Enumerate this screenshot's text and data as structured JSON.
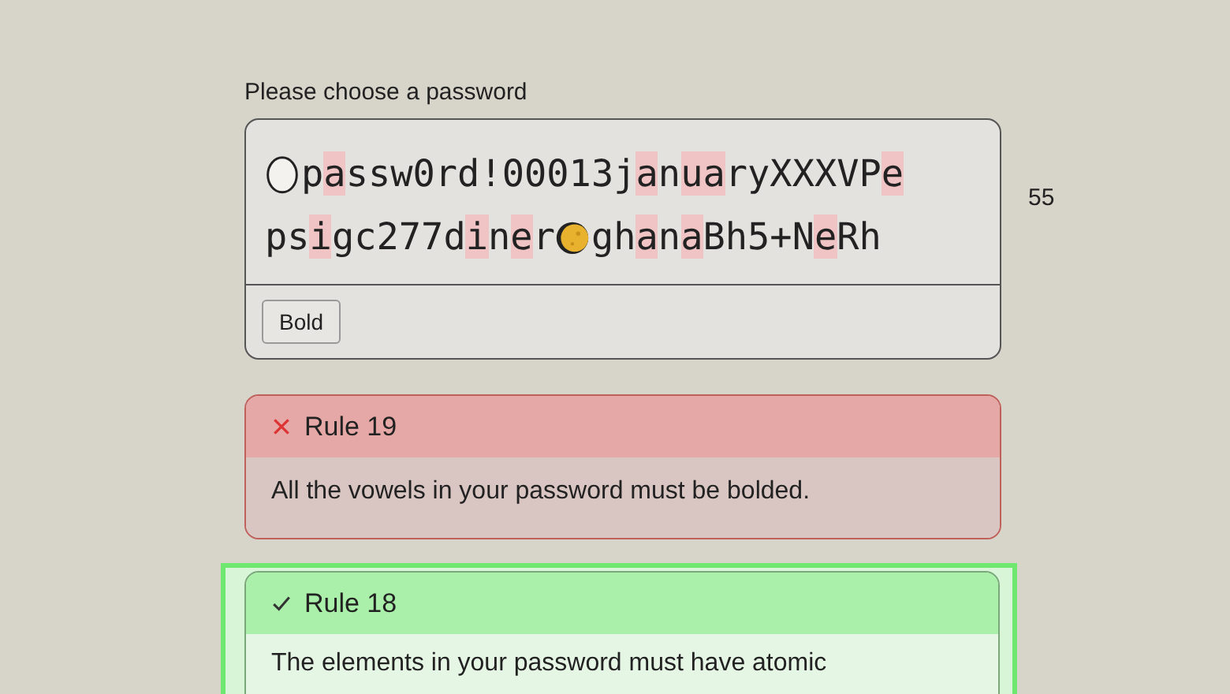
{
  "password_label": "Please choose a password",
  "password_lines": [
    [
      {
        "kind": "egg"
      },
      {
        "kind": "text",
        "text": "p",
        "highlighted": false
      },
      {
        "kind": "text",
        "text": "a",
        "highlighted": true
      },
      {
        "kind": "text",
        "text": "ssw0rd!00013j",
        "highlighted": false
      },
      {
        "kind": "text",
        "text": "a",
        "highlighted": true
      },
      {
        "kind": "text",
        "text": "n",
        "highlighted": false
      },
      {
        "kind": "text",
        "text": "u",
        "highlighted": true
      },
      {
        "kind": "text",
        "text": "a",
        "highlighted": true
      },
      {
        "kind": "text",
        "text": "ryXXXVP",
        "highlighted": false
      },
      {
        "kind": "text",
        "text": "e",
        "highlighted": true
      }
    ],
    [
      {
        "kind": "text",
        "text": "ps",
        "highlighted": false
      },
      {
        "kind": "text",
        "text": "i",
        "highlighted": true
      },
      {
        "kind": "text",
        "text": "gc277d",
        "highlighted": false
      },
      {
        "kind": "text",
        "text": "i",
        "highlighted": true
      },
      {
        "kind": "text",
        "text": "n",
        "highlighted": false
      },
      {
        "kind": "text",
        "text": "e",
        "highlighted": true
      },
      {
        "kind": "text",
        "text": "r",
        "highlighted": false
      },
      {
        "kind": "moon"
      },
      {
        "kind": "text",
        "text": "gh",
        "highlighted": false
      },
      {
        "kind": "text",
        "text": "a",
        "highlighted": true
      },
      {
        "kind": "text",
        "text": "n",
        "highlighted": false
      },
      {
        "kind": "text",
        "text": "a",
        "highlighted": true
      },
      {
        "kind": "text",
        "text": "Bh5+N",
        "highlighted": false
      },
      {
        "kind": "text",
        "text": "e",
        "highlighted": true
      },
      {
        "kind": "text",
        "text": "Rh",
        "highlighted": false
      }
    ]
  ],
  "bold_button": "Bold",
  "length_count": "55",
  "rules": [
    {
      "kind": "failed",
      "title": "Rule 19",
      "text": "All the vowels in your password must be bolded.",
      "highlighted": false
    },
    {
      "kind": "passed",
      "title": "Rule 18",
      "text": "The elements in your password must have atomic",
      "highlighted": true
    }
  ]
}
